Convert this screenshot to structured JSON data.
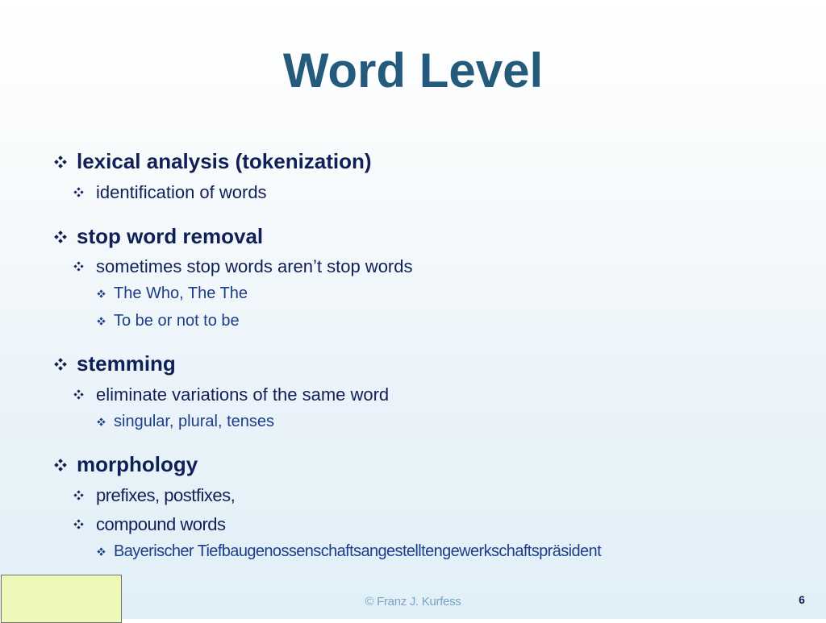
{
  "slide": {
    "title": "Word Level",
    "bullets": [
      {
        "text": "lexical analysis (tokenization)",
        "children": [
          {
            "text": "identification of words"
          }
        ]
      },
      {
        "text": "stop word removal",
        "children": [
          {
            "text": "sometimes stop words aren’t stop words",
            "children": [
              {
                "text": "The Who, The The"
              },
              {
                "text": "To be or not to be"
              }
            ]
          }
        ]
      },
      {
        "text": "stemming",
        "children": [
          {
            "text": "eliminate variations of the same word",
            "children": [
              {
                "text": "singular, plural, tenses"
              }
            ]
          }
        ]
      },
      {
        "text": "morphology",
        "children": [
          {
            "text": "prefixes, postfixes,"
          },
          {
            "text": "compound words",
            "children": [
              {
                "text": "Bayerischer Tiefbaugenossenschaftsangestelltengewerkschaftspräsident"
              }
            ]
          }
        ]
      }
    ],
    "bullet_icon": "diamond-four-dot-icon",
    "footer": {
      "copyright": "© Franz J. Kurfess",
      "page_number": "6"
    },
    "colors": {
      "title": "#245a7c",
      "text": "#0f2057",
      "sub_text": "#1b3d8a",
      "footer_text": "#7aa5c2",
      "note_box": "#eef8b8"
    }
  }
}
